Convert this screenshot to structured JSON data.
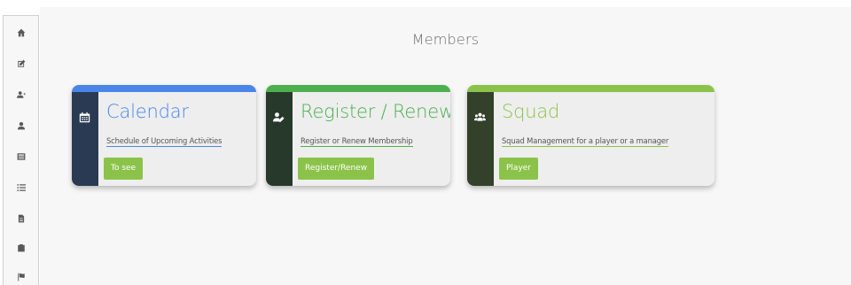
{
  "page": {
    "title": "Members"
  },
  "sidebar": {
    "items": [
      {
        "icon": "home-icon"
      },
      {
        "icon": "edit-icon"
      },
      {
        "icon": "add-user-icon"
      },
      {
        "icon": "user-icon"
      },
      {
        "icon": "list-icon"
      },
      {
        "icon": "list-ul-icon"
      },
      {
        "icon": "file-icon"
      },
      {
        "icon": "clipboard-icon"
      },
      {
        "icon": "flag-icon"
      }
    ]
  },
  "cards": [
    {
      "icon": "calendar-icon",
      "title": "Calendar",
      "link": "Schedule of Upcoming Activities",
      "button": "To see",
      "accent": "#4a86e8",
      "strip": "#2b3a53",
      "link_underline": "#4a86e8"
    },
    {
      "icon": "user-edit-icon",
      "title": "Register / Renew",
      "link": "Register or Renew Membership",
      "button": "Register/Renew",
      "accent": "#4caf50",
      "strip": "#27392a",
      "link_underline": "#4caf50"
    },
    {
      "icon": "users-icon",
      "title": "Squad",
      "link": "Squad Management for a player or a manager",
      "button": "Player",
      "accent": "#8bc34a",
      "strip": "#33402a",
      "link_underline": "#8bc34a"
    }
  ],
  "colors": {
    "button": "#8bc34a",
    "background": "#f7f7f8"
  }
}
